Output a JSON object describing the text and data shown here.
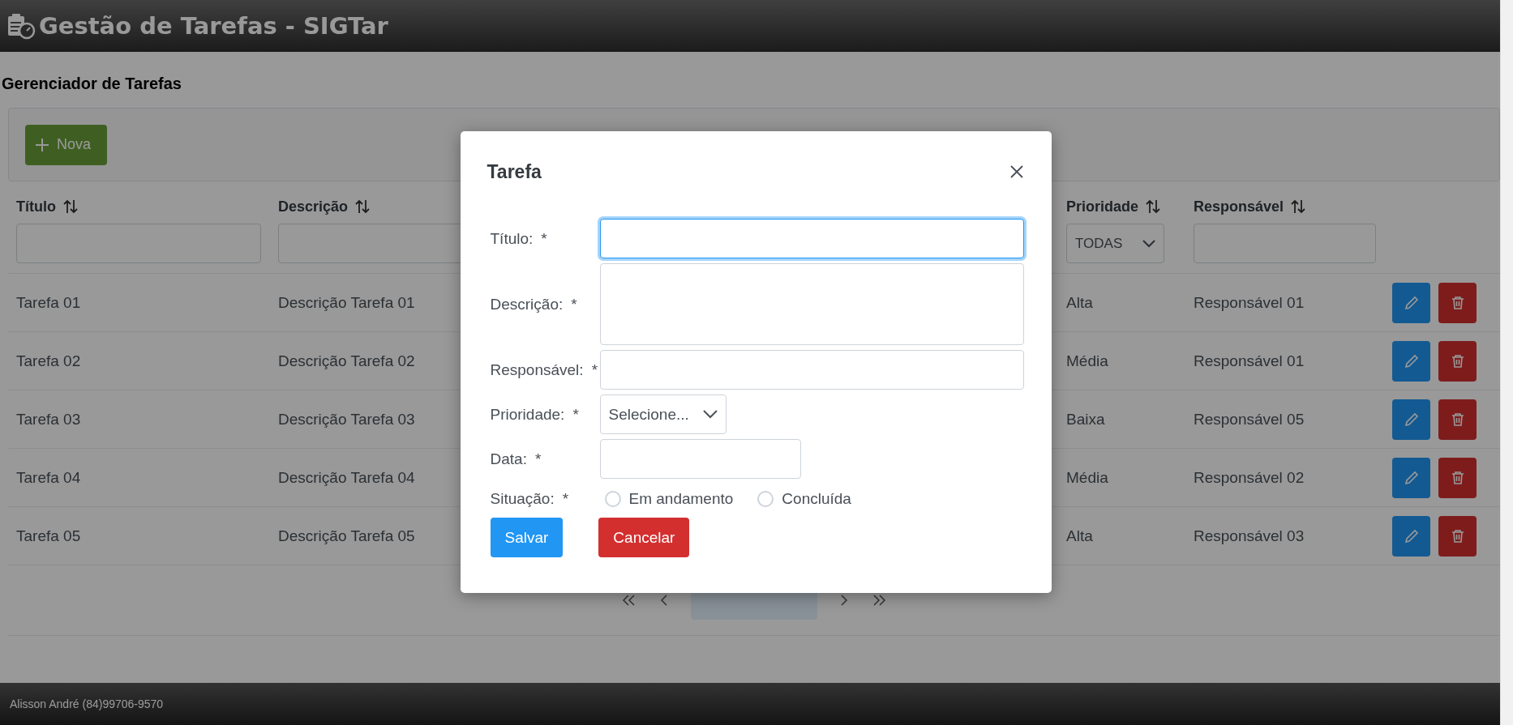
{
  "app_header": {
    "title": "Gestão de Tarefas - SIGTar"
  },
  "page_title": "Gerenciador de Tarefas",
  "toolbar": {
    "new_button": {
      "label": "Nova"
    }
  },
  "table": {
    "columns": [
      {
        "label": "Título",
        "filter": {
          "kind": "text"
        }
      },
      {
        "label": "Descrição",
        "filter": {
          "kind": "text"
        }
      },
      {
        "label": "Prioridade",
        "filter": {
          "kind": "select",
          "value": "TODAS"
        }
      },
      {
        "label": "Responsável",
        "filter": {
          "kind": "text"
        }
      }
    ],
    "rows": [
      {
        "cells": [
          "Tarefa 01",
          "Descrição Tarefa 01",
          "Alta",
          "Responsável 01"
        ]
      },
      {
        "cells": [
          "Tarefa 02",
          "Descrição Tarefa 02",
          "Média",
          "Responsável 01"
        ]
      },
      {
        "cells": [
          "Tarefa 03",
          "Descrição Tarefa 03",
          "Baixa",
          "Responsável 05"
        ]
      },
      {
        "cells": [
          "Tarefa 04",
          "Descrição Tarefa 04",
          "Média",
          "Responsável 02"
        ]
      },
      {
        "cells": [
          "Tarefa 05",
          "Descrição Tarefa 05",
          "Alta",
          "Responsável 03"
        ]
      }
    ]
  },
  "pagination": {
    "pages": [
      {
        "selected": true
      }
    ]
  },
  "dialog": {
    "title": "Tarefa",
    "fields": [
      {
        "label": "Título:",
        "mark": "*",
        "kind": "text",
        "focused": true
      },
      {
        "label": "Descrição:",
        "mark": "*",
        "kind": "textarea",
        "focused": false
      },
      {
        "label": "Responsável:",
        "mark": "*",
        "kind": "text",
        "focused": false
      },
      {
        "label": "Prioridade:",
        "mark": "*",
        "kind": "select",
        "placeholder": "Selecione...",
        "focused": false
      },
      {
        "label": "Data:",
        "mark": "*",
        "kind": "date",
        "focused": false
      },
      {
        "label": "Situação:",
        "mark": "*",
        "kind": "radio",
        "options": [
          {
            "label": "Em andamento",
            "selected": false
          },
          {
            "label": "Concluída",
            "selected": false
          }
        ]
      }
    ],
    "buttons": [
      {
        "label": "Salvar",
        "kind": "primary"
      },
      {
        "label": "Cancelar",
        "kind": "danger"
      }
    ]
  },
  "footer": {
    "text": "Alisson André (84)99706-9570"
  }
}
